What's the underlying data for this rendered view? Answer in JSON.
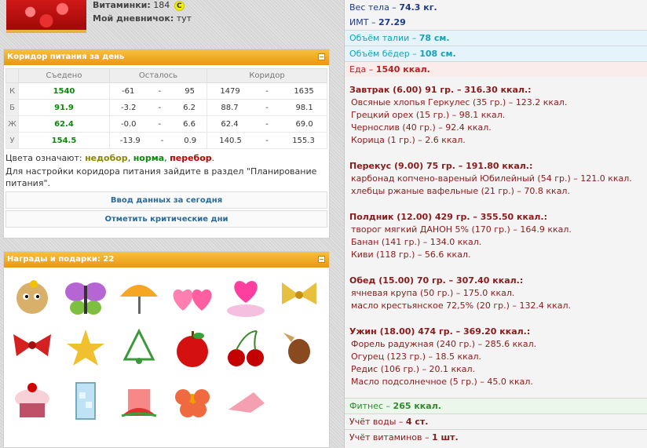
{
  "profile": {
    "vitamins_label": "Витаминки:",
    "vitamins_value": "184",
    "vitamins_badge": "С",
    "diary_label": "Мой дневничок:",
    "diary_value": "тут"
  },
  "corridor": {
    "title": "Коридор питания за день",
    "headers": [
      "Съедено",
      "Осталось",
      "Коридор"
    ],
    "rows": [
      {
        "letter": "К",
        "eaten": "1540",
        "left_min": "-61",
        "left_max": "95",
        "c_min": "1479",
        "c_max": "1635"
      },
      {
        "letter": "Б",
        "eaten": "91.9",
        "left_min": "-3.2",
        "left_max": "6.2",
        "c_min": "88.7",
        "c_max": "98.1"
      },
      {
        "letter": "Ж",
        "eaten": "62.4",
        "left_min": "-0.0",
        "left_max": "6.6",
        "c_min": "62.4",
        "c_max": "69.0"
      },
      {
        "letter": "У",
        "eaten": "154.5",
        "left_min": "-13.9",
        "left_max": "0.9",
        "c_min": "140.5",
        "c_max": "155.3"
      }
    ],
    "dash": "-",
    "colors_prefix": "Цвета означают:",
    "color_under": "недобор",
    "color_norm": "норма",
    "color_over": "перебор",
    "hint": "Для настройки коридора питания зайдите в раздел \"Планирование питания\".",
    "btn_enter": "Ввод данных за сегодня",
    "btn_critical": "Отметить критические дни"
  },
  "gifts": {
    "title": "Награды и подарки: 22",
    "items": [
      "hedgehog-gift-icon",
      "butterfly-gift-icon",
      "umbrella-gift-icon",
      "hearts-gift-icon",
      "heart-cloud-gift-icon",
      "bow-gold-gift-icon",
      "bow-red-gift-icon",
      "star-gift-icon",
      "tree-gift-icon",
      "apple-gift-icon",
      "cherries-gift-icon",
      "candy-gift-icon",
      "cupcake-gift-icon",
      "ice-glass-gift-icon",
      "watermelon-drink-gift-icon",
      "flower-gift-icon",
      "shoe-gift-icon"
    ]
  },
  "summary": {
    "weight_label": "Вес тела",
    "weight_value": "74.3 кг.",
    "bmi_label": "ИМТ",
    "bmi_value": "27.29",
    "waist_label": "Объём талии",
    "waist_value": "78 см.",
    "hips_label": "Объём бёдер",
    "hips_value": "108 см.",
    "food_label": "Еда",
    "food_value": "1540 ккал.",
    "fitness_label": "Фитнес",
    "fitness_value": "265 ккал.",
    "water_label": "Учёт воды",
    "water_value": "4 ст.",
    "vitamins_label": "Учёт витаминов",
    "vitamins_value": "1 шт."
  },
  "meals": [
    {
      "title": "Завтрак (6.00) 91 гр. – 316.30 ккал.:",
      "items": [
        "Овсяные хлопья Геркулес (35 гр.) – 123.2 ккал.",
        "Грецкий орех (15 гр.) – 98.1 ккал.",
        "Чернослив (40 гр.) – 92.4 ккал.",
        "Корица (1 гр.) – 2.6 ккал."
      ]
    },
    {
      "title": "Перекус (9.00) 75 гр. – 191.80 ккал.:",
      "items": [
        "карбонад копчено-вареный Юбилейный (54 гр.) – 121.0 ккал.",
        "хлебцы ржаные вафельные (21 гр.) – 70.8 ккал."
      ]
    },
    {
      "title": "Полдник (12.00) 429 гр. – 355.50 ккал.:",
      "items": [
        "творог мягкий ДАНОН 5% (170 гр.) – 164.9 ккал.",
        "Банан (141 гр.) – 134.0 ккал.",
        "Киви (118 гр.) – 56.6 ккал."
      ]
    },
    {
      "title": "Обед (15.00) 70 гр. – 307.40 ккал.:",
      "items": [
        "ячневая крупа (50 гр.) – 175.0 ккал.",
        "масло крестьянское 72,5% (20 гр.) – 132.4 ккал."
      ]
    },
    {
      "title": "Ужин (18.00) 474 гр. – 369.20 ккал.:",
      "items": [
        "Форель радужная (240 гр.) – 285.6 ккал.",
        "Огурец (123 гр.) – 18.5 ккал.",
        "Редис (106 гр.) – 20.1 ккал.",
        "Масло подсолнечное (5 гр.) – 45.0 ккал."
      ]
    }
  ]
}
